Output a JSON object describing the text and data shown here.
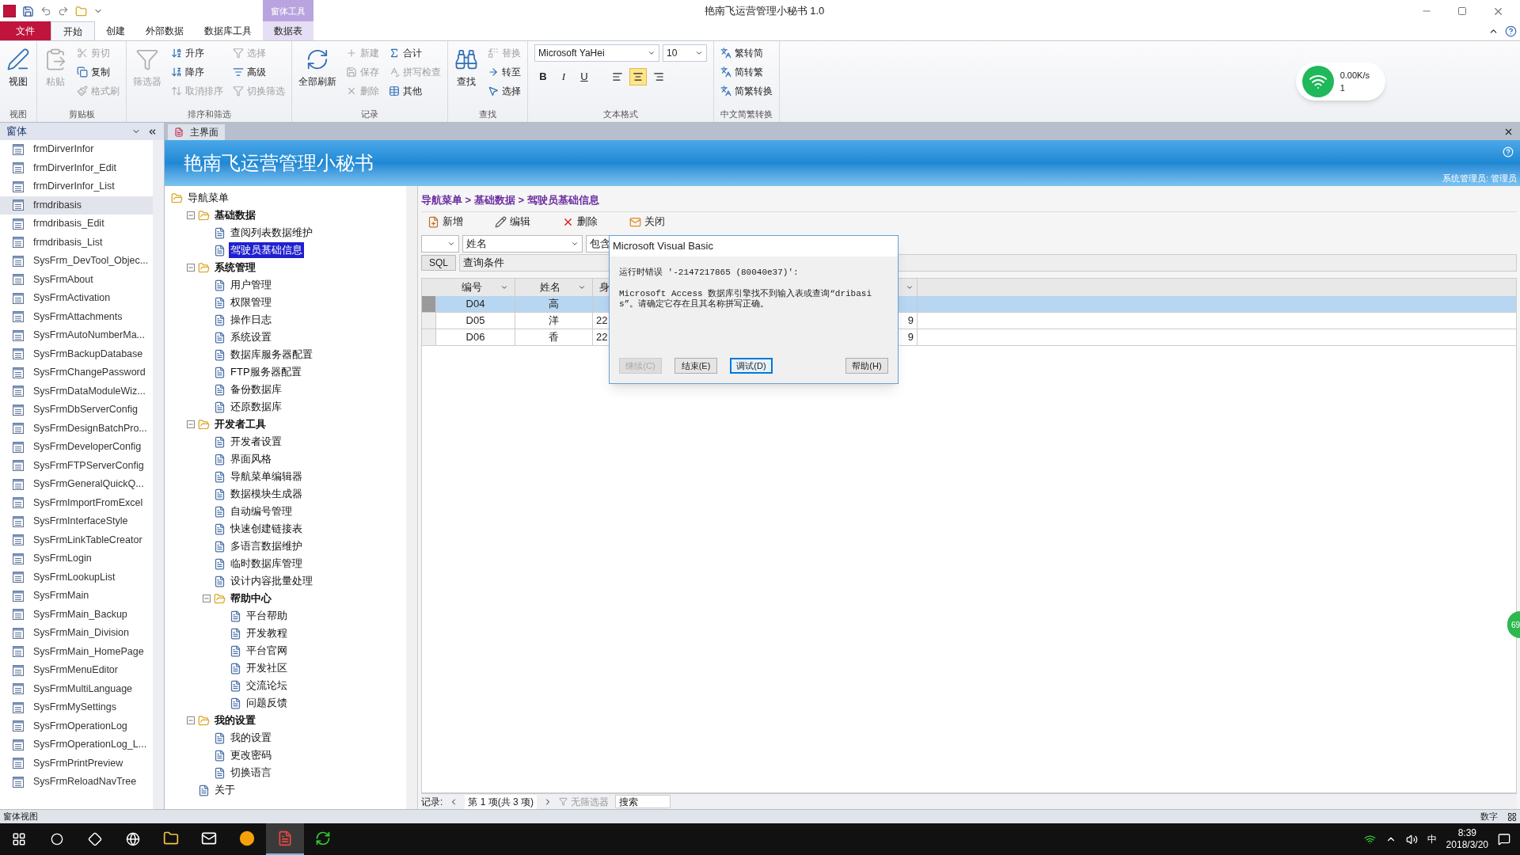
{
  "window": {
    "title": "艳南飞运营管理小秘书 1.0",
    "context_group": "窗体工具"
  },
  "ribbon_tabs": [
    {
      "label": "文件",
      "kind": "file",
      "selected": false
    },
    {
      "label": "开始",
      "kind": "tab",
      "selected": true
    },
    {
      "label": "创建",
      "kind": "tab",
      "selected": false
    },
    {
      "label": "外部数据",
      "kind": "tab",
      "selected": false
    },
    {
      "label": "数据库工具",
      "kind": "tab",
      "selected": false
    },
    {
      "label": "数据表",
      "kind": "context",
      "selected": false
    }
  ],
  "ribbon_groups": [
    {
      "label": "视图",
      "kind": "buttons",
      "columns": [
        [
          {
            "label": "视图",
            "kind": "large",
            "disabled": false
          }
        ]
      ]
    },
    {
      "label": "剪贴板",
      "kind": "buttons",
      "columns": [
        [
          {
            "label": "粘贴",
            "kind": "large",
            "disabled": true
          }
        ],
        [
          {
            "label": "剪切",
            "kind": "small",
            "disabled": true
          },
          {
            "label": "复制",
            "kind": "small",
            "disabled": false
          },
          {
            "label": "格式刷",
            "kind": "small",
            "disabled": true
          }
        ]
      ]
    },
    {
      "label": "排序和筛选",
      "kind": "buttons",
      "columns": [
        [
          {
            "label": "筛选器",
            "kind": "large",
            "disabled": true
          }
        ],
        [
          {
            "label": "升序",
            "kind": "small",
            "disabled": false
          },
          {
            "label": "降序",
            "kind": "small",
            "disabled": false
          },
          {
            "label": "取消排序",
            "kind": "small",
            "disabled": true
          }
        ],
        [
          {
            "label": "选择",
            "kind": "small",
            "disabled": true
          },
          {
            "label": "高级",
            "kind": "small",
            "disabled": false
          },
          {
            "label": "切换筛选",
            "kind": "small",
            "disabled": true
          }
        ]
      ]
    },
    {
      "label": "记录",
      "kind": "buttons",
      "columns": [
        [
          {
            "label": "全部刷新",
            "kind": "large",
            "disabled": false
          }
        ],
        [
          {
            "label": "新建",
            "kind": "small",
            "disabled": true
          },
          {
            "label": "保存",
            "kind": "small",
            "disabled": true
          },
          {
            "label": "删除",
            "kind": "small",
            "disabled": true
          }
        ],
        [
          {
            "label": "合计",
            "kind": "small",
            "disabled": false
          },
          {
            "label": "拼写检查",
            "kind": "small",
            "disabled": true
          },
          {
            "label": "其他",
            "kind": "small",
            "disabled": false
          }
        ]
      ]
    },
    {
      "label": "查找",
      "kind": "buttons",
      "columns": [
        [
          {
            "label": "查找",
            "kind": "large",
            "disabled": false
          }
        ],
        [
          {
            "label": "替换",
            "kind": "small",
            "disabled": true
          },
          {
            "label": "转至",
            "kind": "small",
            "disabled": false
          },
          {
            "label": "选择",
            "kind": "small",
            "disabled": false
          }
        ]
      ]
    },
    {
      "label": "文本格式",
      "kind": "text_format",
      "font": "Microsoft YaHei",
      "size": "10",
      "styles": [
        "B",
        "I",
        "U"
      ],
      "align": [
        {
          "selected": false
        },
        {
          "selected": true
        },
        {
          "selected": false
        }
      ]
    },
    {
      "label": "中文简繁转换",
      "kind": "buttons",
      "columns": [
        [
          {
            "label": "繁转简",
            "kind": "small",
            "disabled": false
          },
          {
            "label": "简转繁",
            "kind": "small",
            "disabled": false
          },
          {
            "label": "简繁转换",
            "kind": "small",
            "disabled": false
          }
        ]
      ]
    }
  ],
  "network_widget": {
    "speed": "0.00K/s",
    "count": "1"
  },
  "nav_pane": {
    "title": "窗体",
    "items": [
      {
        "label": "frmDirverInfor",
        "selected": false
      },
      {
        "label": "frmDirverInfor_Edit",
        "selected": false
      },
      {
        "label": "frmDirverInfor_List",
        "selected": false
      },
      {
        "label": "frmdribasis",
        "selected": true
      },
      {
        "label": "frmdribasis_Edit",
        "selected": false
      },
      {
        "label": "frmdribasis_List",
        "selected": false
      },
      {
        "label": "SysFrm_DevTool_Objec...",
        "selected": false
      },
      {
        "label": "SysFrmAbout",
        "selected": false
      },
      {
        "label": "SysFrmActivation",
        "selected": false
      },
      {
        "label": "SysFrmAttachments",
        "selected": false
      },
      {
        "label": "SysFrmAutoNumberMa...",
        "selected": false
      },
      {
        "label": "SysFrmBackupDatabase",
        "selected": false
      },
      {
        "label": "SysFrmChangePassword",
        "selected": false
      },
      {
        "label": "SysFrmDataModuleWiz...",
        "selected": false
      },
      {
        "label": "SysFrmDbServerConfig",
        "selected": false
      },
      {
        "label": "SysFrmDesignBatchPro...",
        "selected": false
      },
      {
        "label": "SysFrmDeveloperConfig",
        "selected": false
      },
      {
        "label": "SysFrmFTPServerConfig",
        "selected": false
      },
      {
        "label": "SysFrmGeneralQuickQ...",
        "selected": false
      },
      {
        "label": "SysFrmImportFromExcel",
        "selected": false
      },
      {
        "label": "SysFrmInterfaceStyle",
        "selected": false
      },
      {
        "label": "SysFrmLinkTableCreator",
        "selected": false
      },
      {
        "label": "SysFrmLogin",
        "selected": false
      },
      {
        "label": "SysFrmLookupList",
        "selected": false
      },
      {
        "label": "SysFrmMain",
        "selected": false
      },
      {
        "label": "SysFrmMain_Backup",
        "selected": false
      },
      {
        "label": "SysFrmMain_Division",
        "selected": false
      },
      {
        "label": "SysFrmMain_HomePage",
        "selected": false
      },
      {
        "label": "SysFrmMenuEditor",
        "selected": false
      },
      {
        "label": "SysFrmMultiLanguage",
        "selected": false
      },
      {
        "label": "SysFrmMySettings",
        "selected": false
      },
      {
        "label": "SysFrmOperationLog",
        "selected": false
      },
      {
        "label": "SysFrmOperationLog_L...",
        "selected": false
      },
      {
        "label": "SysFrmPrintPreview",
        "selected": false
      },
      {
        "label": "SysFrmReloadNavTree",
        "selected": false
      }
    ]
  },
  "document_tab": "主界面",
  "banner": {
    "title": "艳南飞运营管理小秘书",
    "user": "系统管理员: 管理员"
  },
  "nav_tree": {
    "label": "导航菜单",
    "selected": false,
    "children": [
      {
        "label": "基础数据",
        "selected": false,
        "expanded": true,
        "children": [
          {
            "label": "查阅列表数据维护",
            "selected": false
          },
          {
            "label": "驾驶员基础信息",
            "selected": true
          }
        ]
      },
      {
        "label": "系统管理",
        "selected": false,
        "expanded": true,
        "children": [
          {
            "label": "用户管理",
            "selected": false
          },
          {
            "label": "权限管理",
            "selected": false
          },
          {
            "label": "操作日志",
            "selected": false
          },
          {
            "label": "系统设置",
            "selected": false
          },
          {
            "label": "数据库服务器配置",
            "selected": false
          },
          {
            "label": "FTP服务器配置",
            "selected": false
          },
          {
            "label": "备份数据库",
            "selected": false
          },
          {
            "label": "还原数据库",
            "selected": false
          }
        ]
      },
      {
        "label": "开发者工具",
        "selected": false,
        "expanded": true,
        "children": [
          {
            "label": "开发者设置",
            "selected": false
          },
          {
            "label": "界面风格",
            "selected": false
          },
          {
            "label": "导航菜单编辑器",
            "selected": false
          },
          {
            "label": "数据模块生成器",
            "selected": false
          },
          {
            "label": "自动编号管理",
            "selected": false
          },
          {
            "label": "快速创建链接表",
            "selected": false
          },
          {
            "label": "多语言数据维护",
            "selected": false
          },
          {
            "label": "临时数据库管理",
            "selected": false
          },
          {
            "label": "设计内容批量处理",
            "selected": false
          },
          {
            "label": "帮助中心",
            "selected": false,
            "expanded": true,
            "children": [
              {
                "label": "平台帮助",
                "selected": false
              },
              {
                "label": "开发教程",
                "selected": false
              },
              {
                "label": "平台官网",
                "selected": false
              },
              {
                "label": "开发社区",
                "selected": false
              },
              {
                "label": "交流论坛",
                "selected": false
              },
              {
                "label": "问题反馈",
                "selected": false
              }
            ]
          }
        ]
      },
      {
        "label": "我的设置",
        "selected": false,
        "expanded": true,
        "children": [
          {
            "label": "我的设置",
            "selected": false
          },
          {
            "label": "更改密码",
            "selected": false
          },
          {
            "label": "切换语言",
            "selected": false
          }
        ]
      },
      {
        "label": "关于",
        "selected": false
      }
    ]
  },
  "breadcrumb": "导航菜单 > 基础数据 > 驾驶员基础信息",
  "toolbar": [
    "新增",
    "编辑",
    "删除",
    "关闭"
  ],
  "filter": {
    "field": "姓名",
    "operator": "包含"
  },
  "sql": {
    "button": "SQL",
    "condition": "查询条件"
  },
  "grid": {
    "columns": [
      "编号",
      "姓名",
      "身"
    ],
    "rows": [
      {
        "selected": true,
        "cells": [
          "D04",
          "高"
        ]
      },
      {
        "selected": false,
        "cells": [
          "D05",
          "洋",
          "22",
          "9"
        ]
      },
      {
        "selected": false,
        "cells": [
          "D06",
          "香",
          "22",
          "9"
        ]
      }
    ]
  },
  "record_nav": {
    "label": "记录:",
    "position": "第 1 项(共 3 项)",
    "filter": "无筛选器",
    "search_placeholder": "搜索"
  },
  "dialog": {
    "title": "Microsoft Visual Basic",
    "error": "运行时错误 '-2147217865 (80040e37)':",
    "message": "Microsoft Access 数据库引擎找不到输入表或查询“dribasis”。请确定它存在且其名称拼写正确。",
    "buttons": [
      {
        "label": "继续(C)",
        "disabled": true,
        "selected": false
      },
      {
        "label": "结束(E)",
        "disabled": false,
        "selected": false
      },
      {
        "label": "调试(D)",
        "disabled": false,
        "selected": true
      },
      {
        "label": "帮助(H)",
        "disabled": false,
        "selected": false
      }
    ]
  },
  "side_badge": "69",
  "status_bar": {
    "left": "窗体视图",
    "right": "数字"
  },
  "taskbar": {
    "apps": [
      {
        "selected": false
      },
      {
        "selected": false
      },
      {
        "selected": false
      },
      {
        "selected": true
      },
      {
        "selected": false
      }
    ],
    "ime": "中",
    "time": "8:39",
    "date": "2018/3/20"
  }
}
